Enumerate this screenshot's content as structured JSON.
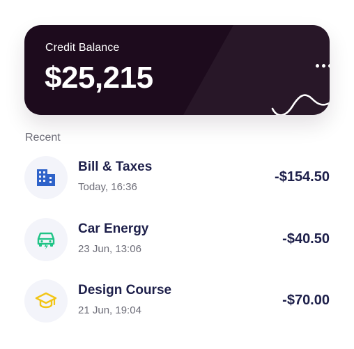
{
  "balance_card": {
    "label": "Credit Balance",
    "amount": "$25,215",
    "background_color": "#1d0b1d",
    "menu_icon": "more-horizontal-icon",
    "trend_icon": "wave-icon"
  },
  "recent": {
    "title": "Recent",
    "transactions": [
      {
        "title": "Bill & Taxes",
        "time": "Today, 16:36",
        "amount": "-$154.50",
        "icon": "building-icon",
        "icon_color": "#2f63c9"
      },
      {
        "title": "Car Energy",
        "time": "23 Jun, 13:06",
        "amount": "-$40.50",
        "icon": "electric-car-icon",
        "icon_color": "#1fc486"
      },
      {
        "title": "Design Course",
        "time": "21 Jun, 19:04",
        "amount": "-$70.00",
        "icon": "graduation-cap-icon",
        "icon_color": "#f2c515"
      }
    ]
  },
  "colors": {
    "text_primary": "#1d1f4a",
    "text_secondary": "#6d6d78",
    "icon_background": "#f3f4fa"
  }
}
